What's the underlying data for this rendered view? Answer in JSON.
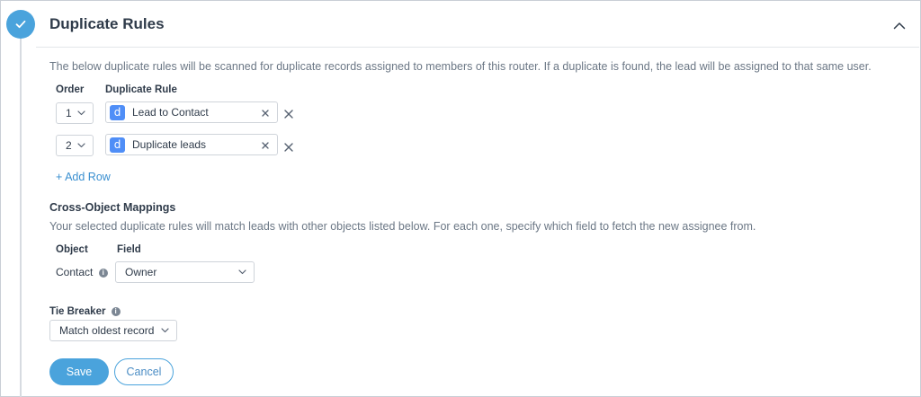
{
  "panel": {
    "title": "Duplicate Rules",
    "description": "The below duplicate rules will be scanned for duplicate records assigned to members of this router. If a duplicate is found, the lead will be assigned to that same user."
  },
  "rules_table": {
    "order_header": "Order",
    "rule_header": "Duplicate Rule",
    "rows": [
      {
        "order": "1",
        "rule": "Lead to Contact",
        "icon_letter": "d"
      },
      {
        "order": "2",
        "rule": "Duplicate leads",
        "icon_letter": "d"
      }
    ],
    "remove_glyph": "×",
    "add_row_label": "+ Add Row"
  },
  "cross_object": {
    "title": "Cross-Object Mappings",
    "description": "Your selected duplicate rules will match leads with other objects listed below. For each one, specify which field to fetch the new assignee from.",
    "object_header": "Object",
    "field_header": "Field",
    "object_value": "Contact",
    "field_value": "Owner"
  },
  "tie_breaker": {
    "label": "Tie Breaker",
    "value": "Match oldest record"
  },
  "actions": {
    "save_label": "Save",
    "cancel_label": "Cancel"
  },
  "icons": {
    "step": "check-icon",
    "collapse": "chevron-up-icon",
    "info": "info-icon",
    "dropdown": "chevron-down-icon"
  },
  "colors": {
    "accent": "#4aa3dc",
    "link": "#3a8fd0",
    "rule_badge": "#4f8ef7"
  }
}
